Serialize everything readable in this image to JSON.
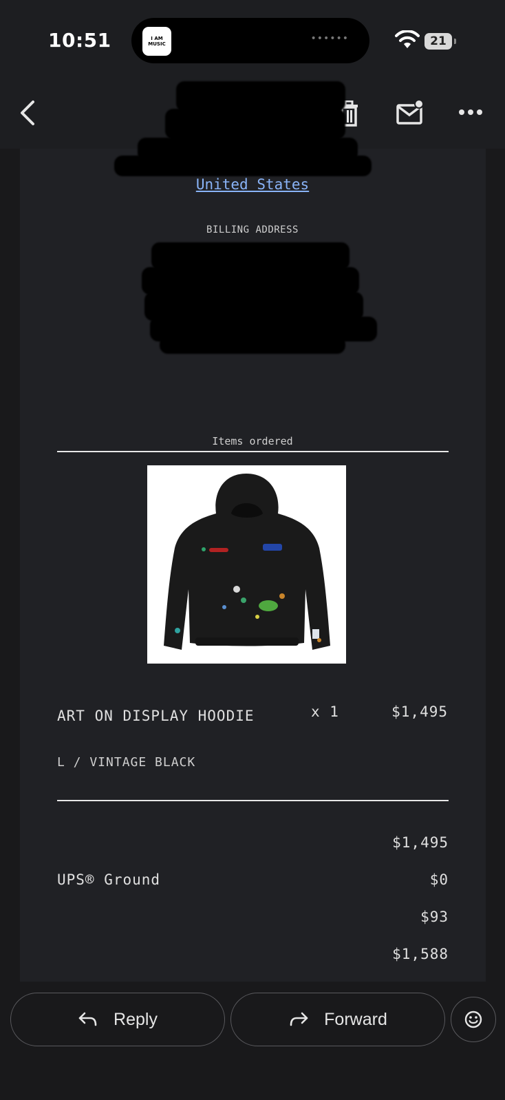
{
  "status": {
    "time": "10:51",
    "app_badge": "I AM MUSIC",
    "battery": "21"
  },
  "toolbar": {
    "back_icon": "chevron-left-icon",
    "trash_icon": "trash-icon",
    "mail_icon": "mail-unread-icon",
    "more_icon": "more-horizontal-icon"
  },
  "email": {
    "shipping_country_link": "United States",
    "billing_label": "BILLING ADDRESS",
    "items_title": "Items ordered",
    "item": {
      "name": "ART ON DISPLAY HOODIE",
      "variant": "L / VINTAGE BLACK",
      "quantity": "x 1",
      "price": "$1,495"
    },
    "summary": [
      {
        "label": "",
        "value": "$1,495"
      },
      {
        "label": "UPS® Ground",
        "value": "$0"
      },
      {
        "label": "",
        "value": "$93"
      },
      {
        "label": "",
        "value": "$1,588"
      }
    ]
  },
  "actions": {
    "reply_label": "Reply",
    "forward_label": "Forward",
    "emoji_icon": "smiley-icon"
  },
  "colors": {
    "link": "#8ab4f8",
    "background": "#19191b",
    "card": "#202125"
  }
}
